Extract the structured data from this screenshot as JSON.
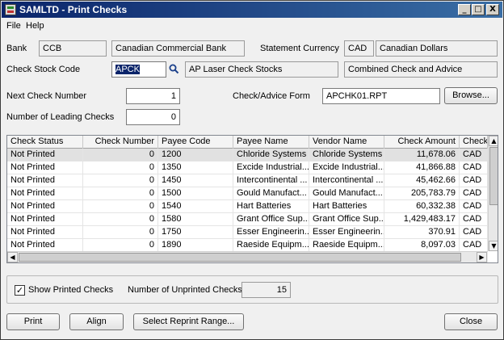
{
  "window": {
    "title": "SAMLTD - Print Checks",
    "min_glyph": "_",
    "max_glyph": "□",
    "close_glyph": "X"
  },
  "menu": [
    "File",
    "Help"
  ],
  "bank": {
    "label": "Bank",
    "code": "CCB",
    "name": "Canadian Commercial Bank"
  },
  "statement_currency": {
    "label": "Statement Currency",
    "code": "CAD",
    "name": "Canadian Dollars"
  },
  "check_stock": {
    "label": "Check Stock Code",
    "code": "APCK",
    "description": "AP Laser Check Stocks",
    "type": "Combined Check and Advice",
    "finder_icon": "magnifier-icon"
  },
  "next_check": {
    "label": "Next Check Number",
    "value": "1"
  },
  "leading_checks": {
    "label": "Number of Leading Checks",
    "value": "0"
  },
  "advice_form": {
    "label": "Check/Advice Form",
    "value": "APCHK01.RPT",
    "browse_label": "Browse..."
  },
  "grid": {
    "columns": [
      "Check Status",
      "Check Number",
      "Payee Code",
      "Payee Name",
      "Vendor Name",
      "Check Amount",
      "Check"
    ],
    "rows": [
      [
        "Not Printed",
        "0",
        "1200",
        "Chloride Systems",
        "Chloride Systems",
        "11,678.06",
        "CAD"
      ],
      [
        "Not Printed",
        "0",
        "1350",
        "Excide Industrial...",
        "Excide Industrial...",
        "41,866.88",
        "CAD"
      ],
      [
        "Not Printed",
        "0",
        "1450",
        "Intercontinental ...",
        "Intercontinental ...",
        "45,462.66",
        "CAD"
      ],
      [
        "Not Printed",
        "0",
        "1500",
        "Gould Manufact...",
        "Gould Manufact...",
        "205,783.79",
        "CAD"
      ],
      [
        "Not Printed",
        "0",
        "1540",
        "Hart Batteries",
        "Hart Batteries",
        "60,332.38",
        "CAD"
      ],
      [
        "Not Printed",
        "0",
        "1580",
        "Grant Office Sup...",
        "Grant Office Sup...",
        "1,429,483.17",
        "CAD"
      ],
      [
        "Not Printed",
        "0",
        "1750",
        "Esser Engineerin...",
        "Esser Engineerin...",
        "370.91",
        "CAD"
      ],
      [
        "Not Printed",
        "0",
        "1890",
        "Raeside Equipm...",
        "Raeside Equipm...",
        "8,097.03",
        "CAD"
      ]
    ]
  },
  "show_printed": {
    "label": "Show Printed Checks",
    "checked": true,
    "check_glyph": "✓"
  },
  "unprinted": {
    "label": "Number of Unprinted Checks",
    "value": "15"
  },
  "buttons": {
    "print": "Print",
    "align": "Align",
    "reprint": "Select Reprint Range...",
    "close": "Close"
  },
  "scroll_glyphs": {
    "up": "▲",
    "down": "▼",
    "left": "◀",
    "right": "▶"
  }
}
